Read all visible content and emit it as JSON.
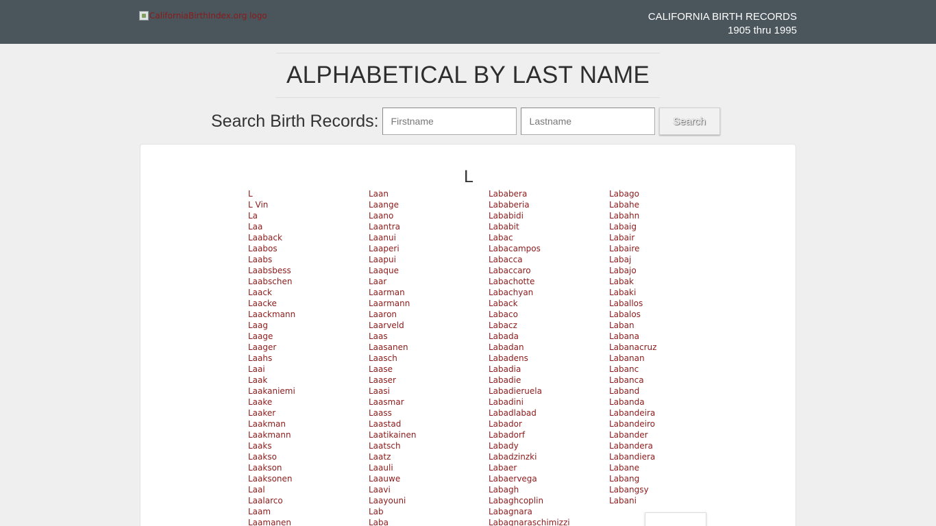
{
  "header": {
    "logo_alt": "CaliforniaBirthIndex.org logo",
    "title_line1": "CALIFORNIA BIRTH RECORDS",
    "title_line2": "1905 thru 1995"
  },
  "page": {
    "title": "ALPHABETICAL BY LAST NAME"
  },
  "search": {
    "label": "Search Birth Records:",
    "firstname_placeholder": "Firstname",
    "lastname_placeholder": "Lastname",
    "button_label": "Search"
  },
  "listing": {
    "letter": "L",
    "columns": [
      [
        "L",
        "L Vin",
        "La",
        "Laa",
        "Laaback",
        "Laabos",
        "Laabs",
        "Laabsbess",
        "Laabschen",
        "Laack",
        "Laacke",
        "Laackmann",
        "Laag",
        "Laage",
        "Laager",
        "Laahs",
        "Laai",
        "Laak",
        "Laakaniemi",
        "Laake",
        "Laaker",
        "Laakman",
        "Laakmann",
        "Laaks",
        "Laakso",
        "Laakson",
        "Laaksonen",
        "Laal",
        "Laalarco",
        "Laam",
        "Laamanen"
      ],
      [
        "Laan",
        "Laange",
        "Laano",
        "Laantra",
        "Laanui",
        "Laaperi",
        "Laapui",
        "Laaque",
        "Laar",
        "Laarman",
        "Laarmann",
        "Laaron",
        "Laarveld",
        "Laas",
        "Laasanen",
        "Laasch",
        "Laase",
        "Laaser",
        "Laasi",
        "Laasmar",
        "Laass",
        "Laastad",
        "Laatikainen",
        "Laatsch",
        "Laatz",
        "Laauli",
        "Laauwe",
        "Laavi",
        "Laayouni",
        "Lab",
        "Laba"
      ],
      [
        "Lababera",
        "Lababeria",
        "Lababidi",
        "Lababit",
        "Labac",
        "Labacampos",
        "Labacca",
        "Labaccaro",
        "Labachotte",
        "Labachyan",
        "Laback",
        "Labaco",
        "Labacz",
        "Labada",
        "Labadan",
        "Labadens",
        "Labadia",
        "Labadie",
        "Labadieruela",
        "Labadini",
        "Labadlabad",
        "Labador",
        "Labadorf",
        "Labady",
        "Labadzinzki",
        "Labaer",
        "Labaervega",
        "Labagh",
        "Labaghcoplin",
        "Labagnara",
        "Labagnaraschimizzi"
      ],
      [
        "Labago",
        "Labahe",
        "Labahn",
        "Labaig",
        "Labair",
        "Labaire",
        "Labaj",
        "Labajo",
        "Labak",
        "Labaki",
        "Laballos",
        "Labalos",
        "Laban",
        "Labana",
        "Labanacruz",
        "Labanan",
        "Labanc",
        "Labanca",
        "Laband",
        "Labanda",
        "Labandeira",
        "Labandeiro",
        "Labander",
        "Labandera",
        "Labandiera",
        "Labane",
        "Labang",
        "Labangsy",
        "Labani"
      ]
    ]
  }
}
